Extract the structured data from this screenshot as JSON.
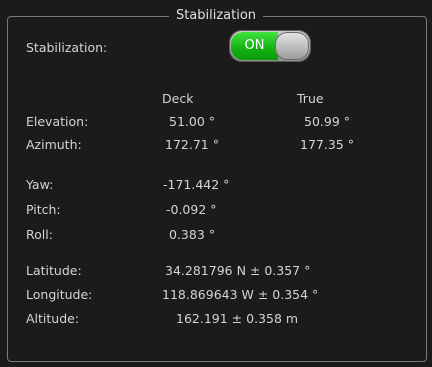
{
  "panel": {
    "title": "Stabilization"
  },
  "stabilization": {
    "label": "Stabilization:",
    "toggle_state": "ON"
  },
  "orientation": {
    "headers": {
      "deck": "Deck",
      "true": "True"
    },
    "elevation": {
      "label": "Elevation:",
      "deck": "51.00 °",
      "true": "50.99 °"
    },
    "azimuth": {
      "label": "Azimuth:",
      "deck": "172.71 °",
      "true": "177.35 °"
    }
  },
  "attitude": {
    "yaw": {
      "label": "Yaw:",
      "value": "-171.442 °"
    },
    "pitch": {
      "label": "Pitch:",
      "value": "-0.092 °"
    },
    "roll": {
      "label": "Roll:",
      "value": "0.383 °"
    }
  },
  "position": {
    "latitude": {
      "label": "Latitude:",
      "value": "34.281796 N ±  0.357 °"
    },
    "longitude": {
      "label": "Longitude:",
      "value": "118.869643 W ±  0.354 °"
    },
    "altitude": {
      "label": "Altitude:",
      "value": "162.191  ±  0.358 m"
    }
  },
  "colors": {
    "toggle_on": "#15b515",
    "background": "#1b1b1b",
    "text": "#d4d4d4",
    "border": "#7a7a7a"
  }
}
